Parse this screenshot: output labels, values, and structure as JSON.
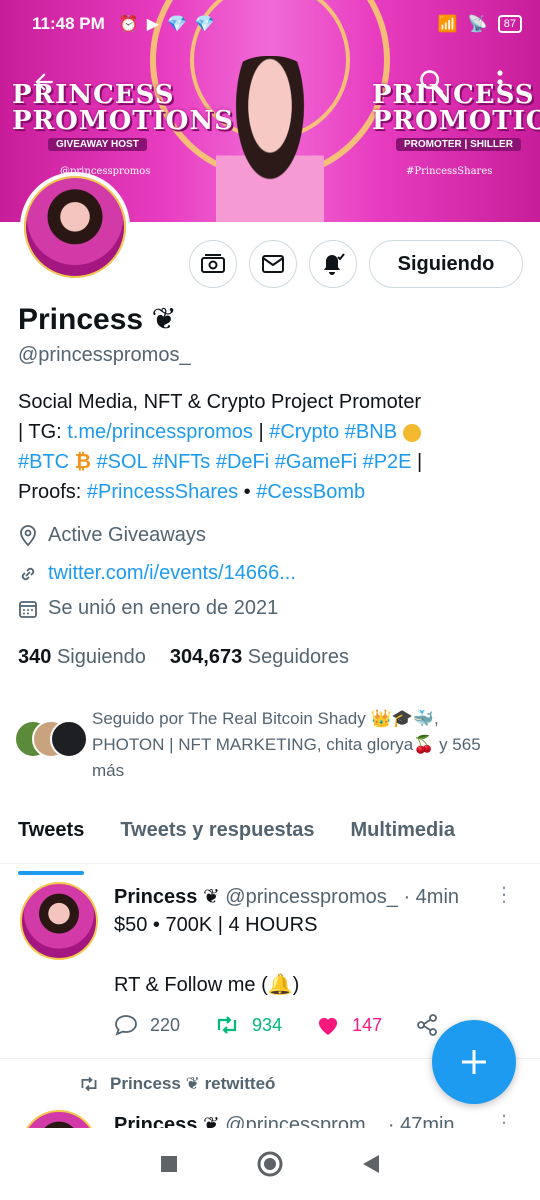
{
  "status_bar": {
    "time": "11:48 PM",
    "battery": "87"
  },
  "banner": {
    "left_title_line1": "PRINCESS",
    "left_title_line2": "PROMOTIONS",
    "left_subtitle": "GIVEAWAY HOST",
    "left_tag": "@princesspromos",
    "right_title_line1": "PRINCESS",
    "right_title_line2": "PROMOTIONS",
    "right_subtitle": "PROMOTER | SHILLER",
    "right_tag": "#PrincessShares"
  },
  "profile": {
    "name": "Princess",
    "name_emoji": "❦",
    "handle": "@princesspromos_",
    "follow_button": "Siguiendo",
    "bio": {
      "line1": "Social Media, NFT & Crypto Project Promoter",
      "tg_prefix": "| TG: ",
      "tg_link": "t.me/princesspromos",
      "sep1": " | ",
      "tags1": "#Crypto #BNB",
      "tags2_a": "#BTC",
      "tags2_b": "#SOL #NFTs #DeFi #GameFi #P2E",
      "tags2_sep": " |",
      "proofs_prefix": "Proofs: ",
      "proofs_tag": "#PrincessShares",
      "proofs_sep": "  • ",
      "proofs_tag2": "#CessBomb"
    },
    "location": "Active Giveaways",
    "link": "twitter.com/i/events/14666...",
    "joined": "Se unió en enero de 2021",
    "following_count": "340",
    "following_label": "Siguiendo",
    "followers_count": "304,673",
    "followers_label": "Seguidores",
    "followed_by": "Seguido por The Real Bitcoin Shady 👑🎓🐳, PHOTON | NFT MARKETING, chita glorya🍒 y 565 más"
  },
  "tabs": [
    {
      "label": "Tweets"
    },
    {
      "label": "Tweets y respuestas"
    },
    {
      "label": "Multimedia"
    }
  ],
  "tweets": [
    {
      "name": "Princess",
      "handle": "@princesspromos_",
      "time": "· 4min",
      "text": "$50 • 700K | 4 HOURS\n\nRT & Follow me (🔔)",
      "replies": "220",
      "retweets": "934",
      "likes": "147"
    },
    {
      "retweet_label": "Princess ❦ retwitteó",
      "name": "Princess",
      "handle": "@princessprom...",
      "time": "· 47min"
    }
  ],
  "colors": {
    "accent": "#1d9bf0",
    "like": "#f91880",
    "retweet": "#00ba7c"
  }
}
